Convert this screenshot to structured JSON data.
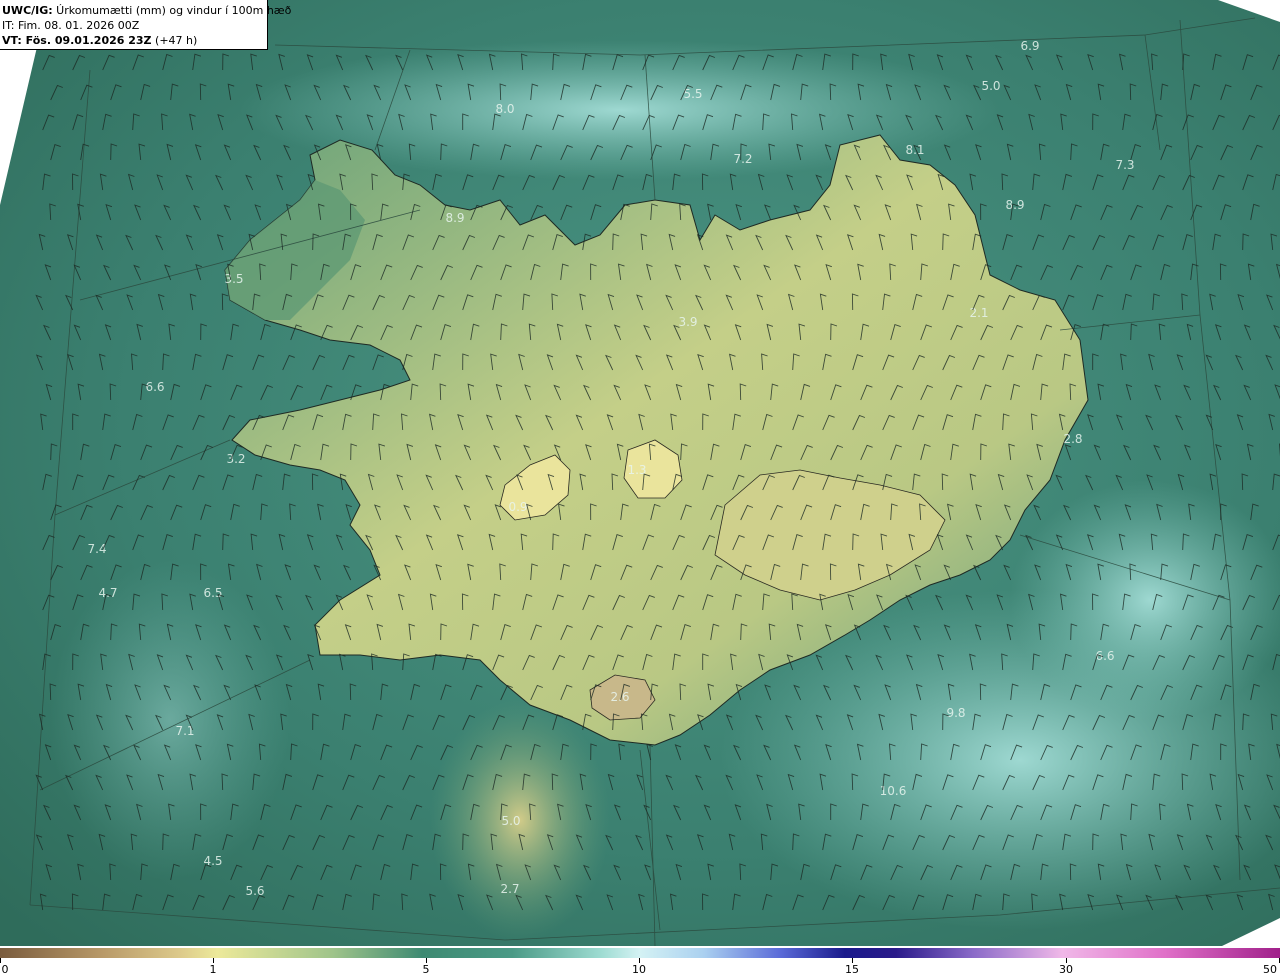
{
  "header": {
    "line1_bold": "UWC/IG:",
    "line1_rest": " Úrkomumætti (mm) og vindur í 100m hæð",
    "line2": "IT: Fim. 08. 01. 2026 00Z",
    "line3_bold": "VT: Fös. 09.01.2026 23Z",
    "line3_rest": " (+47 h)"
  },
  "map_labels": [
    "6.9",
    "5.0",
    "8.0",
    "5.5",
    "7.2",
    "8.1",
    "7.3",
    "8.9",
    "8.9",
    "3.5",
    "3.9",
    "2.1",
    "6.6",
    "3.2",
    "2.8",
    "1.3",
    "0.9",
    "7.4",
    "4.7",
    "6.5",
    "6.6",
    "2.6",
    "9.8",
    "7.1",
    "10.6",
    "5.0",
    "4.5",
    "5.6",
    "2.7"
  ],
  "colorbar": {
    "ticks": [
      "0",
      "1",
      "5",
      "10",
      "15",
      "30",
      "50"
    ]
  },
  "colors": {
    "sea_dark": "#2f6e5c",
    "sea_teal": "#4f9e8c",
    "sea_light": "#9fdcd0",
    "land_green": "#5c9a6e",
    "land_yellow": "#d8dc8c",
    "glacier": "#e8e49c"
  }
}
